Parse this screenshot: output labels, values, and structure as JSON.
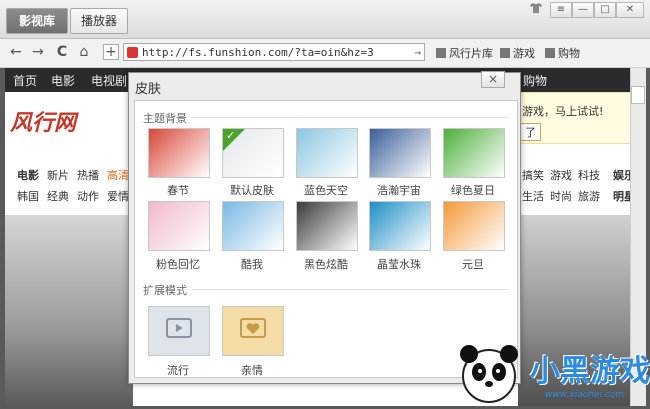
{
  "tabs": [
    "影视库",
    "播放器"
  ],
  "window_controls": {
    "shirt": "shirt-icon",
    "menu": "≡",
    "min": "—",
    "max": "□",
    "close": "✕"
  },
  "nav": {
    "back": "←",
    "forward": "→",
    "refresh": "C",
    "home": "⌂",
    "add": "+",
    "url": "http://fs.funshion.com/?ta=oin&hz=3",
    "go": "→",
    "bookmarks": [
      "风行片库",
      "游戏",
      "购物"
    ]
  },
  "site": {
    "nav": [
      "首页",
      "电影",
      "电视剧",
      "购物"
    ],
    "logo": "风行网",
    "promo_text": "游戏，马上试试!",
    "promo_button": "了",
    "categories_row1": [
      "电影",
      "新片",
      "热播",
      "高清"
    ],
    "categories_row2": [
      "韩国",
      "经典",
      "动作",
      "爱情"
    ],
    "right_row1": [
      "搞笑",
      "游戏",
      "科技",
      "娱乐"
    ],
    "right_row2": [
      "生活",
      "时尚",
      "旅游",
      "明星"
    ]
  },
  "dialog": {
    "title": "皮肤",
    "close": "×",
    "section1": "主题背景",
    "section2": "扩展模式",
    "skins": [
      {
        "name": "春节",
        "color": "#d9473a"
      },
      {
        "name": "默认皮肤",
        "color": "#e4e6ea"
      },
      {
        "name": "蓝色天空",
        "color": "#8cc6e0"
      },
      {
        "name": "浩瀚宇宙",
        "color": "#3a5f9a"
      },
      {
        "name": "绿色夏日",
        "color": "#4caf3c"
      },
      {
        "name": "粉色回忆",
        "color": "#f0b8c8"
      },
      {
        "name": "酷我",
        "color": "#7ab8e4"
      },
      {
        "name": "黑色炫酷",
        "color": "#3b3b3b"
      },
      {
        "name": "晶莹水珠",
        "color": "#1e8fc6"
      },
      {
        "name": "元旦",
        "color": "#f39a3a"
      }
    ],
    "modes": [
      {
        "name": "流行",
        "color": "#dfe3ea"
      },
      {
        "name": "亲情",
        "color": "#f3dca6"
      }
    ],
    "selected_skin": "默认皮肤"
  },
  "watermark": {
    "text": "小黑游戏",
    "url": "www.xiaohei.com"
  }
}
